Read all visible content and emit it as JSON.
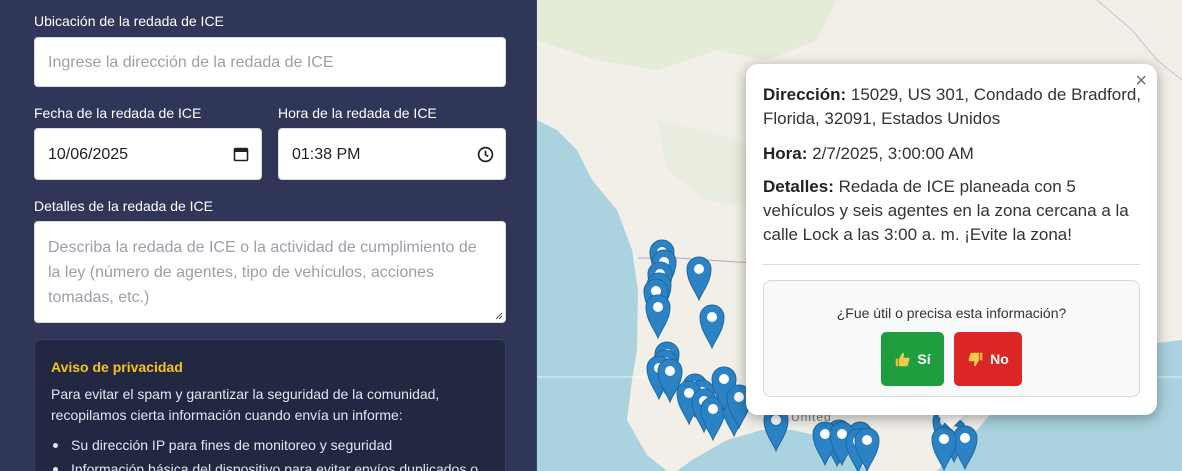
{
  "form": {
    "location_label": "Ubicación de la redada de ICE",
    "location_placeholder": "Ingrese la dirección de la redada de ICE",
    "date_label": "Fecha de la redada de ICE",
    "date_value": "10/06/2025",
    "time_label": "Hora de la redada de ICE",
    "time_value": "01:38 PM",
    "details_label": "Detalles de la redada de ICE",
    "details_placeholder": "Describa la redada de ICE o la actividad de cumplimiento de la ley (número de agentes, tipo de vehículos, acciones tomadas, etc.)"
  },
  "privacy": {
    "title": "Aviso de privacidad",
    "body": "Para evitar el spam y garantizar la seguridad de la comunidad, recopilamos cierta información cuando envía un informe:",
    "items": [
      "Su dirección IP para fines de monitoreo y seguridad",
      "Información básica del dispositivo para evitar envíos duplicados o"
    ]
  },
  "map": {
    "country_label": "United",
    "marker_color": "#2b83c5"
  },
  "popup": {
    "address_label": "Dirección:",
    "address_value": "15029, US 301, Condado de Bradford, Florida, 32091, Estados Unidos",
    "time_label": "Hora:",
    "time_value": "2/7/2025, 3:00:00 AM",
    "details_label": "Detalles:",
    "details_value": "Redada de ICE planeada con 5 vehículos y seis agentes en la zona cercana a la calle Lock a las 3:00 a. m. ¡Evite la zona!",
    "close_glyph": "×",
    "feedback_question": "¿Fue útil o precisa esta información?",
    "yes_label": "Sí",
    "no_label": "No",
    "yes_color": "#1f9e3f",
    "no_color": "#dc2626"
  }
}
